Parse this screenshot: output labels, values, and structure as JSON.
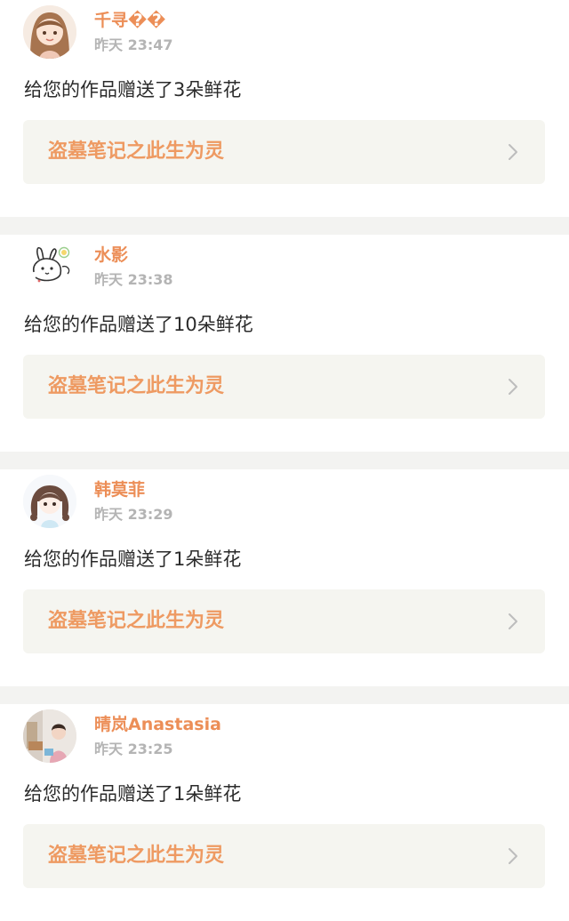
{
  "notifications": [
    {
      "user": "千寻��",
      "time": "昨天 23:47",
      "message": "给您的作品赠送了3朵鲜花",
      "work_title": "盗墓笔记之此生为灵",
      "avatar_icon": "girl-avatar-icon"
    },
    {
      "user": "水影",
      "time": "昨天 23:38",
      "message": "给您的作品赠送了10朵鲜花",
      "work_title": "盗墓笔记之此生为灵",
      "avatar_icon": "rabbit-sketch-avatar-icon"
    },
    {
      "user": "韩莫菲",
      "time": "昨天 23:29",
      "message": "给您的作品赠送了1朵鲜花",
      "work_title": "盗墓笔记之此生为灵",
      "avatar_icon": "anime-girl-avatar-icon"
    },
    {
      "user": "晴岚Anastasia",
      "time": "昨天 23:25",
      "message": "给您的作品赠送了1朵鲜花",
      "work_title": "盗墓笔记之此生为灵",
      "avatar_icon": "photo-avatar-icon"
    }
  ],
  "colors": {
    "accent": "#ec8e57",
    "link_bg": "#f5f5f0",
    "divider": "#f3f3f1",
    "muted": "#b4b4b4"
  }
}
